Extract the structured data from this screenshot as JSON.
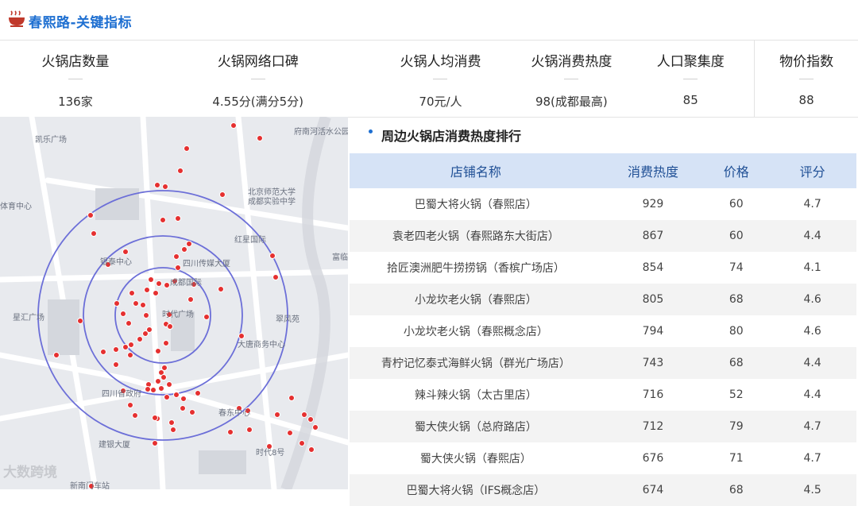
{
  "header": {
    "title": "春熙路-关键指标",
    "logo_icon": "hotpot-icon"
  },
  "metrics": [
    {
      "label": "火锅店数量",
      "value": "136家"
    },
    {
      "label": "火锅网络口碑",
      "value": "4.55分(满分5分)"
    },
    {
      "label": "火锅人均消费",
      "value": "70元/人"
    },
    {
      "label": "火锅消费热度",
      "value": "98(成都最高)"
    },
    {
      "label": "人口聚集度",
      "value": "85"
    },
    {
      "label": "物价指数",
      "value": "88"
    }
  ],
  "map": {
    "poi_labels": [
      "府南河活水公园",
      "凯乐广场",
      "北京师范大学",
      "成都实验中学",
      "体育中心",
      "红星国际",
      "四川传媒大厦",
      "富临",
      "银泰中心",
      "成都国际",
      "时代广场",
      "星汇广场",
      "翠风苑",
      "大唐商务中心",
      "四川省政府",
      "春东中心",
      "建银大厦",
      "时代8号",
      "新南门车站"
    ],
    "marker_color": "#e53030",
    "ring_color": "#6c6fd8"
  },
  "ranking": {
    "title": "周边火锅店消费热度排行",
    "columns": [
      "店铺名称",
      "消费热度",
      "价格",
      "评分"
    ],
    "rows": [
      {
        "name": "巴蜀大将火锅（春熙店）",
        "heat": "929",
        "price": "60",
        "score": "4.7"
      },
      {
        "name": "袁老四老火锅（春熙路东大街店）",
        "heat": "867",
        "price": "60",
        "score": "4.4"
      },
      {
        "name": "拾匠澳洲肥牛捞捞锅（香槟广场店）",
        "heat": "854",
        "price": "74",
        "score": "4.1"
      },
      {
        "name": "小龙坎老火锅（春熙店）",
        "heat": "805",
        "price": "68",
        "score": "4.6"
      },
      {
        "name": "小龙坎老火锅（春熙概念店）",
        "heat": "794",
        "price": "80",
        "score": "4.6"
      },
      {
        "name": "青柠记忆泰式海鲜火锅（群光广场店）",
        "heat": "743",
        "price": "68",
        "score": "4.4"
      },
      {
        "name": "辣斗辣火锅（太古里店）",
        "heat": "716",
        "price": "52",
        "score": "4.4"
      },
      {
        "name": "蜀大侠火锅（总府路店）",
        "heat": "712",
        "price": "79",
        "score": "4.7"
      },
      {
        "name": "蜀大侠火锅（春熙店）",
        "heat": "676",
        "price": "71",
        "score": "4.7"
      },
      {
        "name": "巴蜀大将火锅（IFS概念店）",
        "heat": "674",
        "price": "68",
        "score": "4.5"
      }
    ]
  },
  "watermark": "大数跨境"
}
